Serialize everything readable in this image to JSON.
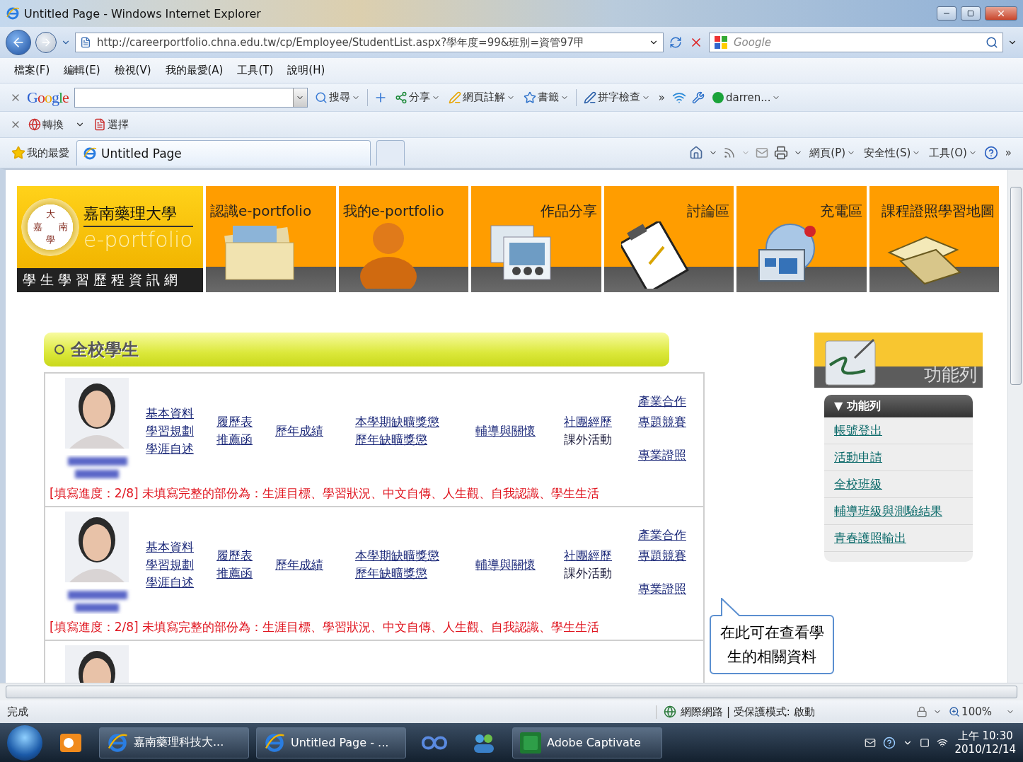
{
  "window": {
    "title": "Untitled Page - Windows Internet Explorer"
  },
  "address_bar": {
    "url": "http://careerportfolio.chna.edu.tw/cp/Employee/StudentList.aspx?學年度=99&班別=資管97甲",
    "search_placeholder": "Google"
  },
  "menu_bar": [
    "檔案(F)",
    "編輯(E)",
    "檢視(V)",
    "我的最愛(A)",
    "工具(T)",
    "說明(H)"
  ],
  "google_toolbar": {
    "logo": "Google",
    "items": [
      {
        "label": "搜尋",
        "kind": "search"
      },
      {
        "label": "分享",
        "kind": "share"
      },
      {
        "label": "網頁註解",
        "kind": "note"
      },
      {
        "label": "書籤",
        "kind": "bookmark"
      },
      {
        "label": "拼字檢查",
        "kind": "spell"
      },
      {
        "label": "»",
        "kind": "more"
      },
      {
        "label": "darren...",
        "kind": "user"
      }
    ]
  },
  "convert_toolbar": {
    "items": [
      {
        "label": "轉換",
        "kind": "convert"
      },
      {
        "label": "選擇",
        "kind": "select"
      }
    ]
  },
  "favorites_bar": {
    "favorites": "我的最愛",
    "tabs": [
      {
        "label": "Untitled Page",
        "selected": true
      }
    ],
    "commands": [
      "網頁(P)",
      "安全性(S)",
      "工具(O)"
    ],
    "more": "»"
  },
  "banner": {
    "seal": [
      "大",
      "嘉",
      "南",
      "學"
    ],
    "school": "嘉南藥理大學",
    "subtitle": "e-portfolio",
    "tagline": "學生學習歷程資訊網",
    "tabs": [
      {
        "label": "認識e-portfolio",
        "kind": "folder"
      },
      {
        "label": "我的e-portfolio",
        "kind": "person"
      },
      {
        "label": "作品分享",
        "kind": "slides"
      },
      {
        "label": "討論區",
        "kind": "clipboard"
      },
      {
        "label": "充電區",
        "kind": "globe"
      },
      {
        "label": "課程證照學習地圖",
        "kind": "books"
      }
    ]
  },
  "section_title": "全校學生",
  "students": [
    {
      "groups": [
        {
          "kind": "stacked",
          "links": [
            {
              "text": "基本資料",
              "link": true
            },
            {
              "text": "學習規劃",
              "link": true
            },
            {
              "text": "學涯自述",
              "link": true
            }
          ]
        },
        {
          "kind": "stacked",
          "links": [
            {
              "text": "履歷表",
              "link": true
            },
            {
              "text": "推薦函",
              "link": true
            }
          ]
        },
        {
          "kind": "stacked",
          "links": [
            {
              "text": "歷年成績",
              "link": true
            }
          ]
        },
        {
          "kind": "stacked",
          "links": [
            {
              "text": "本學期缺曠獎懲",
              "link": true
            },
            {
              "text": "歷年缺曠獎懲",
              "link": true
            }
          ]
        },
        {
          "kind": "stacked",
          "links": [
            {
              "text": "輔導與關懷",
              "link": true
            }
          ]
        },
        {
          "kind": "stacked",
          "links": [
            {
              "text": "社團經歷",
              "link": true
            },
            {
              "text": "課外活動",
              "link": false
            }
          ]
        },
        {
          "kind": "spread",
          "links": [
            {
              "text": "產業合作",
              "link": true
            },
            {
              "text": "專題競賽",
              "link": true
            },
            {
              "text": "專業證照",
              "link": true
            }
          ]
        }
      ],
      "progress": "[填寫進度：2/8] 未填寫完整的部份為：生涯目標、學習狀況、中文自傳、人生觀、自我認識、學生生活"
    },
    {
      "groups": [
        {
          "kind": "stacked",
          "links": [
            {
              "text": "基本資料",
              "link": true
            },
            {
              "text": "學習規劃",
              "link": true
            },
            {
              "text": "學涯自述",
              "link": true
            }
          ]
        },
        {
          "kind": "stacked",
          "links": [
            {
              "text": "履歷表",
              "link": true
            },
            {
              "text": "推薦函",
              "link": true
            }
          ]
        },
        {
          "kind": "stacked",
          "links": [
            {
              "text": "歷年成績",
              "link": true
            }
          ]
        },
        {
          "kind": "stacked",
          "links": [
            {
              "text": "本學期缺曠獎懲",
              "link": true
            },
            {
              "text": "歷年缺曠獎懲",
              "link": true
            }
          ]
        },
        {
          "kind": "stacked",
          "links": [
            {
              "text": "輔導與關懷",
              "link": true
            }
          ]
        },
        {
          "kind": "stacked",
          "links": [
            {
              "text": "社團經歷",
              "link": true
            },
            {
              "text": "課外活動",
              "link": false
            }
          ]
        },
        {
          "kind": "spread",
          "links": [
            {
              "text": "產業合作",
              "link": true
            },
            {
              "text": "專題競賽",
              "link": true
            },
            {
              "text": "專業證照",
              "link": true
            }
          ]
        }
      ],
      "progress": "[填寫進度：2/8] 未填寫完整的部份為：生涯目標、學習狀況、中文自傳、人生觀、自我認識、學生生活"
    },
    {
      "kind": "cut"
    }
  ],
  "sidebar": {
    "header": "功能列",
    "menu_title": "▼ 功能列",
    "items": [
      "帳號登出",
      "活動申請",
      "全校班級",
      "輔導班級與測驗結果",
      "青春護照輸出"
    ]
  },
  "callout": "在此可在查看學生的相關資料",
  "status_bar": {
    "text": "完成",
    "zone": "網際網路 | 受保護模式: 啟動",
    "zoom": "100%"
  },
  "taskbar": {
    "buttons": [
      {
        "label": "嘉南藥理科技大...",
        "kind": "ie"
      },
      {
        "label": "Untitled Page - ...",
        "kind": "ie"
      },
      {
        "label": "Adobe Captivate",
        "kind": "captivate"
      }
    ],
    "time": "上午 10:30",
    "date": "2010/12/14"
  }
}
